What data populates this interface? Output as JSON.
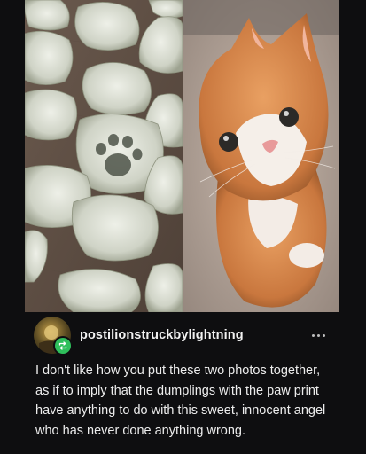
{
  "post": {
    "username": "postilionstruckbylightning",
    "body": "I don't like how you put these two photos together, as if to imply that the dumplings with the paw print have anything to do with this sweet, innocent angel who has never done anything wrong.",
    "more_icon": "ellipsis-icon",
    "reblog_icon": "reblog-icon"
  },
  "colors": {
    "background": "#0e0e10",
    "reblog_badge": "#2fbf5c",
    "text": "#ededed"
  }
}
